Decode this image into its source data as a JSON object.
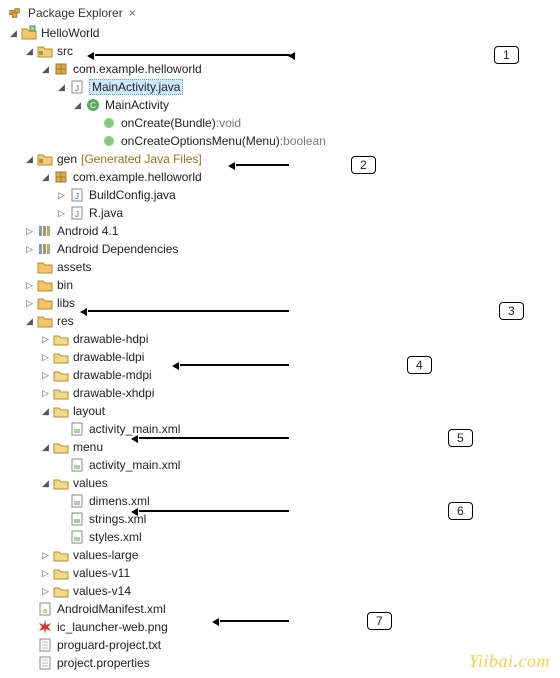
{
  "header": {
    "title": "Package Explorer",
    "close": "×"
  },
  "project": "HelloWorld",
  "src": {
    "label": "src",
    "pkg": "com.example.helloworld",
    "file": "MainActivity.java",
    "class": "MainActivity",
    "methods": {
      "m1": {
        "name": "onCreate(Bundle)",
        "sep": " : ",
        "ret": "void"
      },
      "m2": {
        "name": "onCreateOptionsMenu(Menu)",
        "sep": " : ",
        "ret": "boolean"
      }
    }
  },
  "gen": {
    "label": "gen",
    "decor": "[Generated Java Files]",
    "pkg": "com.example.helloworld",
    "files": {
      "f1": "BuildConfig.java",
      "f2": "R.java"
    }
  },
  "libs": {
    "android": "Android 4.1",
    "deps": "Android Dependencies"
  },
  "folders": {
    "assets": "assets",
    "bin": "bin",
    "libsf": "libs",
    "res": "res",
    "hdpi": "drawable-hdpi",
    "ldpi": "drawable-ldpi",
    "mdpi": "drawable-mdpi",
    "xhdpi": "drawable-xhdpi",
    "layout": "layout",
    "layout_file": "activity_main.xml",
    "menu": "menu",
    "menu_file": "activity_main.xml",
    "values": "values",
    "dimens": "dimens.xml",
    "strings": "strings.xml",
    "styles": "styles.xml",
    "values_large": "values-large",
    "values_v11": "values-v11",
    "values_v14": "values-v14"
  },
  "root_files": {
    "manifest": "AndroidManifest.xml",
    "launcher": "ic_launcher-web.png",
    "proguard": "proguard-project.txt",
    "props": "project.properties"
  },
  "annotations": {
    "a1": "1",
    "a2": "2",
    "a3": "3",
    "a4": "4",
    "a5": "5",
    "a6": "6",
    "a7": "7"
  },
  "watermark": {
    "a": "Yiibai",
    "b": ".",
    "c": "com"
  }
}
